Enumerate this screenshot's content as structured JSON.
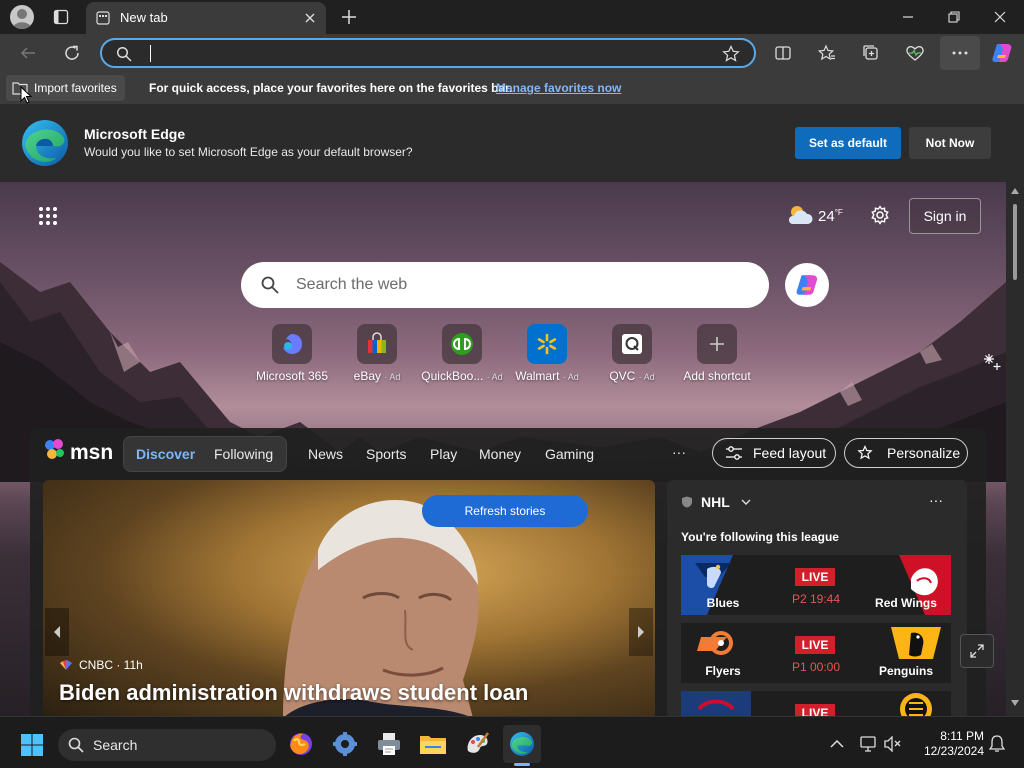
{
  "tab": {
    "title": "New tab"
  },
  "address": {
    "value": ""
  },
  "favbar": {
    "import_label": "Import favorites",
    "message": "For quick access, place your favorites here on the favorites bar.",
    "link": "Manage favorites now"
  },
  "banner": {
    "title": "Microsoft Edge",
    "text": "Would you like to set Microsoft Edge as your default browser?",
    "set_default": "Set as default",
    "not_now": "Not Now"
  },
  "page": {
    "weather_temp": "24",
    "weather_unit": "°F",
    "sign_in": "Sign in",
    "search_placeholder": "Search the web"
  },
  "shortcuts": [
    {
      "label": "Microsoft 365",
      "ad": ""
    },
    {
      "label": "eBay",
      "ad": "· Ad"
    },
    {
      "label": "QuickBoo...",
      "ad": "· Ad"
    },
    {
      "label": "Walmart",
      "ad": "· Ad"
    },
    {
      "label": "QVC",
      "ad": "· Ad"
    },
    {
      "label": "Add shortcut",
      "ad": ""
    }
  ],
  "msn": {
    "brand": "msn",
    "tabs": [
      "Discover",
      "Following"
    ],
    "nav": [
      "News",
      "Sports",
      "Play",
      "Money",
      "Gaming"
    ],
    "more": "···",
    "feed_layout": "Feed layout",
    "personalize": "Personalize",
    "refresh": "Refresh stories",
    "hero_source": "CNBC · 11h",
    "hero_headline": "Biden administration withdraws student loan"
  },
  "nhl": {
    "title": "NHL",
    "more": "···",
    "subtitle": "You're following this league",
    "games": [
      {
        "home": "Blues",
        "away": "Red Wings",
        "status": "LIVE",
        "clock": "P2 19:44"
      },
      {
        "home": "Flyers",
        "away": "Penguins",
        "status": "LIVE",
        "clock": "P1 00:00"
      },
      {
        "home": "",
        "away": "",
        "status": "LIVE",
        "clock": ""
      }
    ]
  },
  "taskbar": {
    "search_label": "Search",
    "time": "8:11 PM",
    "date": "12/23/2024"
  },
  "colors": {
    "accent": "#0f6cbd",
    "live": "#d21f2c",
    "link": "#7fb8ff"
  }
}
